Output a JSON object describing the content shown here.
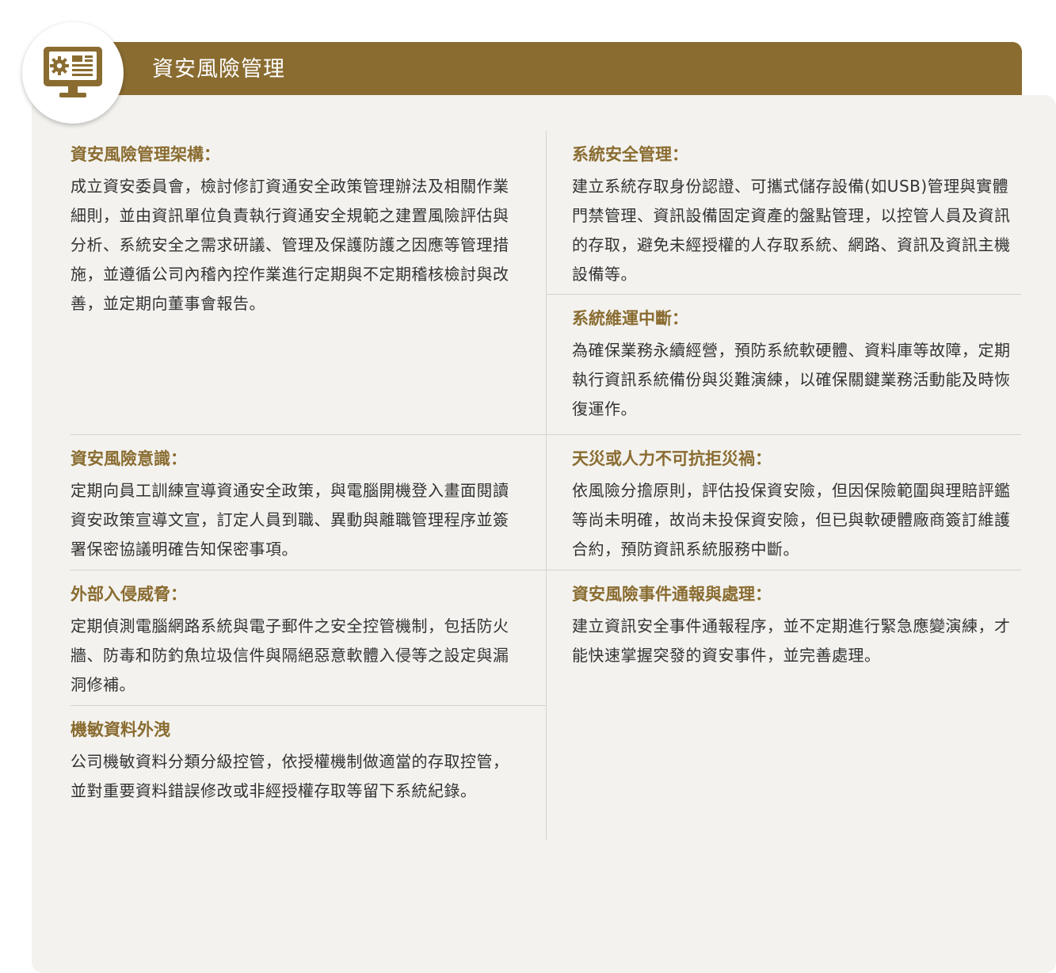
{
  "header": {
    "title": "資安風險管理",
    "icon": "monitor-settings-icon",
    "accent_color": "#8a6c31"
  },
  "sections": {
    "framework": {
      "title": "資安風險管理架構：",
      "body": "成立資安委員會，檢討修訂資通安全政策管理辦法及相關作業細則，並由資訊單位負責執行資通安全規範之建置風險評估與分析、系統安全之需求研議、管理及保護防護之因應等管理措施，並遵循公司內稽內控作業進行定期與不定期稽核檢討與改善，並定期向董事會報告。"
    },
    "system_security": {
      "title": "系統安全管理：",
      "body": "建立系統存取身份認證、可攜式儲存設備(如USB)管理與實體門禁管理、資訊設備固定資產的盤點管理，以控管人員及資訊的存取，避免未經授權的人存取系統、網路、資訊及資訊主機設備等。"
    },
    "operation_interruption": {
      "title": "系統維運中斷：",
      "body": "為確保業務永續經營，預防系統軟硬體、資料庫等故障，定期執行資訊系統備份與災難演練，以確保關鍵業務活動能及時恢復運作。"
    },
    "awareness": {
      "title": "資安風險意識：",
      "body": "定期向員工訓練宣導資通安全政策，與電腦開機登入畫面閱讀資安政策宣導文宣，訂定人員到職、異動與離職管理程序並簽署保密協議明確告知保密事項。"
    },
    "force_majeure": {
      "title": "天災或人力不可抗拒災禍：",
      "body": "依風險分擔原則，評估投保資安險，但因保險範圍與理賠評鑑等尚未明確，故尚未投保資安險，但已與軟硬體廠商簽訂維護合約，預防資訊系統服務中斷。"
    },
    "intrusion": {
      "title": "外部入侵威脅：",
      "body": "定期偵測電腦網路系統與電子郵件之安全控管機制，包括防火牆、防毒和防釣魚垃圾信件與隔絕惡意軟體入侵等之設定與漏洞修補。"
    },
    "incident": {
      "title": "資安風險事件通報與處理：",
      "body": "建立資訊安全事件通報程序，並不定期進行緊急應變演練，才能快速掌握突發的資安事件，並完善處理。"
    },
    "leakage": {
      "title": "機敏資料外洩",
      "body": "公司機敏資料分類分級控管，依授權機制做適當的存取控管，並對重要資料錯誤修改或非經授權存取等留下系統紀錄。"
    }
  }
}
